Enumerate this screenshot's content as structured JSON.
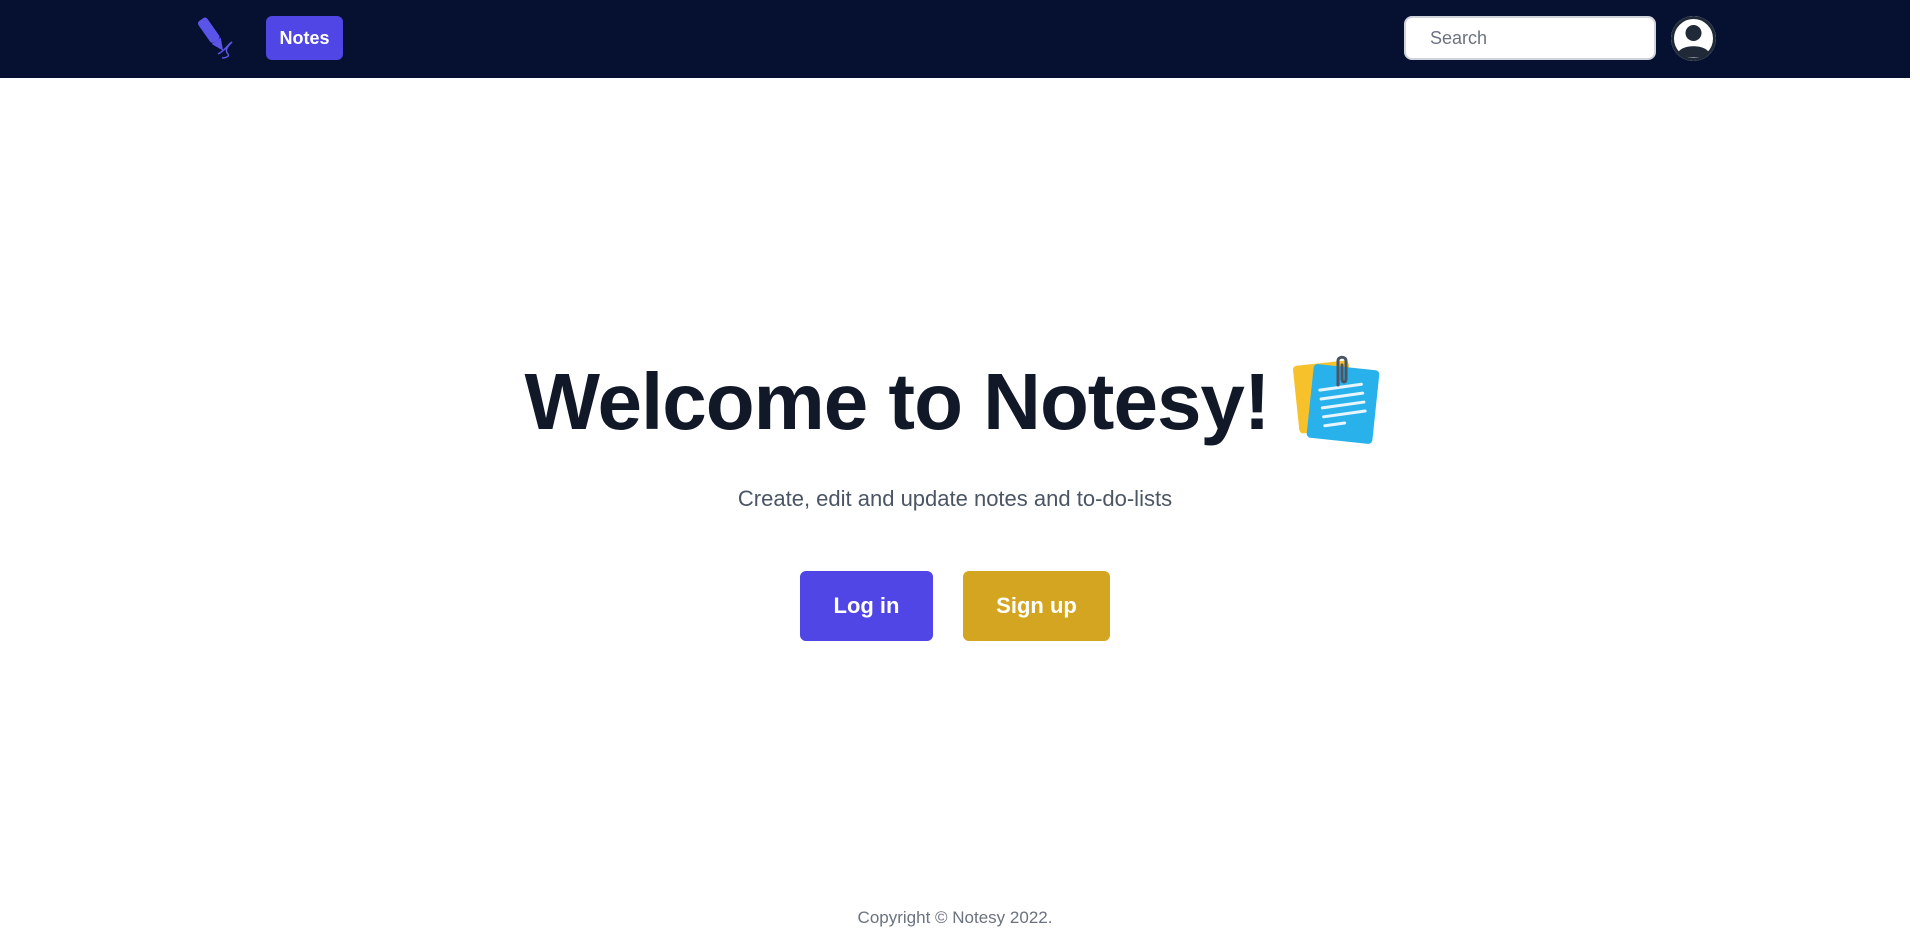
{
  "navbar": {
    "notes_label": "Notes",
    "search_placeholder": "Search",
    "search_value": ""
  },
  "hero": {
    "title": "Welcome to Notesy!",
    "subtitle": "Create, edit and update notes and to-do-lists",
    "login_label": "Log in",
    "signup_label": "Sign up"
  },
  "footer": {
    "copyright": "Copyright © Notesy 2022."
  },
  "icons": {
    "logo": "fountain-pen-icon",
    "notepad": "notepad-icon",
    "avatar": "user-avatar-icon"
  },
  "colors": {
    "navbar_bg": "#061131",
    "primary": "#4f46e5",
    "accent": "#d4a520",
    "title_text": "#111827"
  }
}
